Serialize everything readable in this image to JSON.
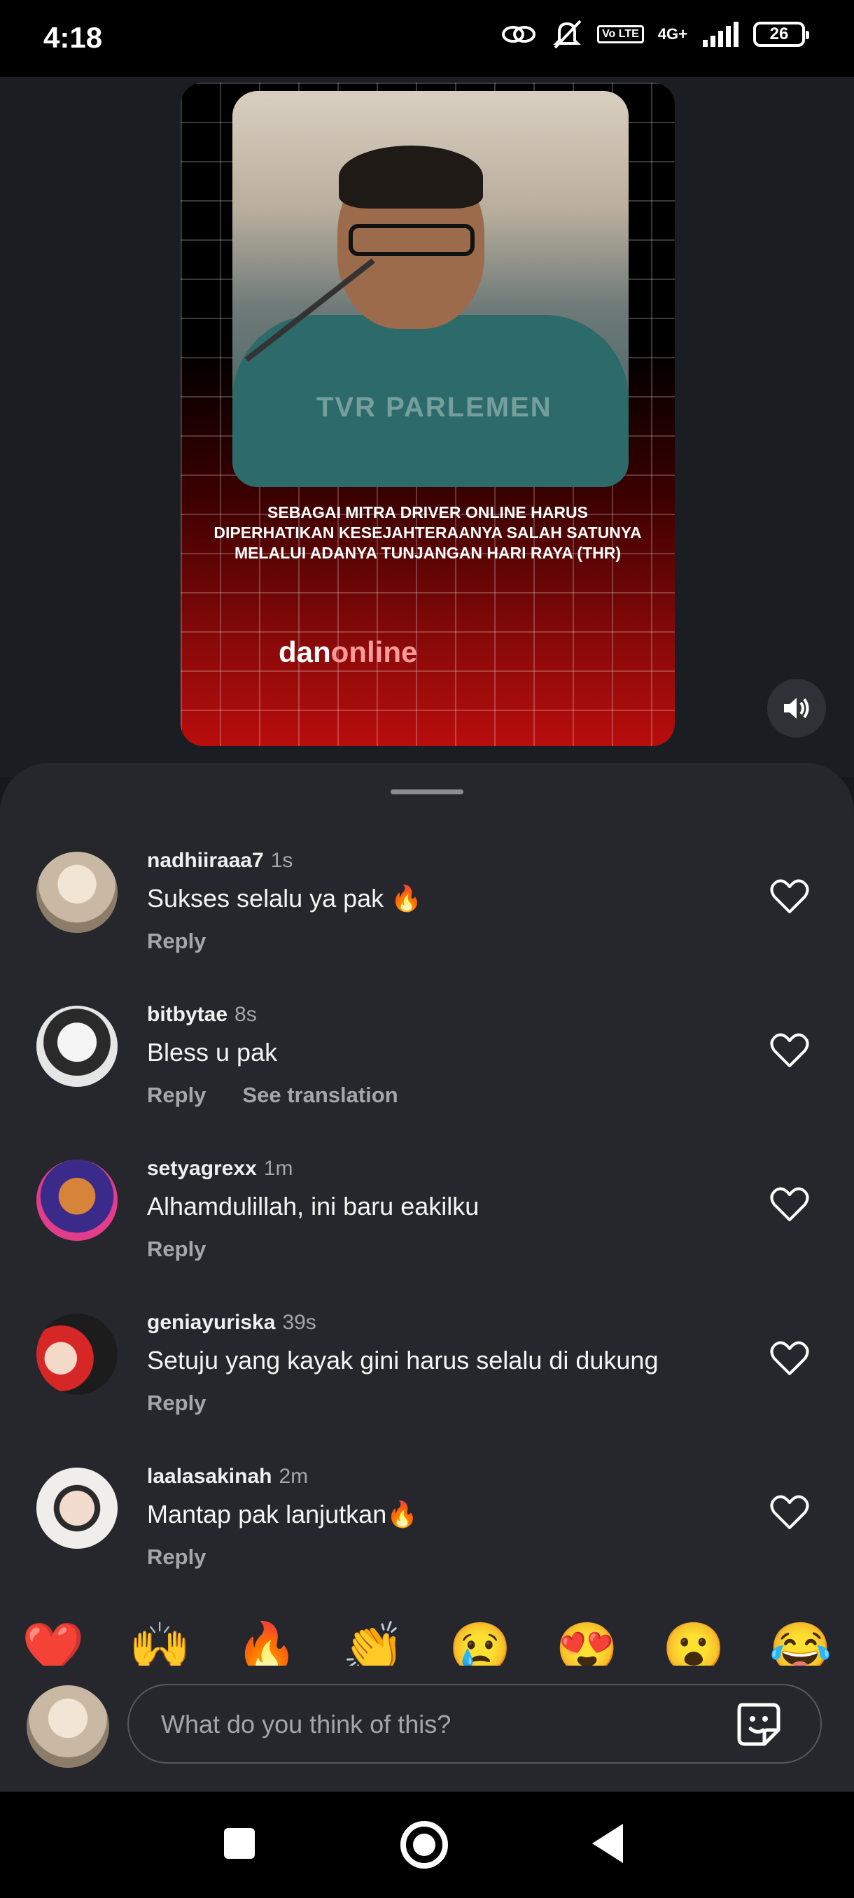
{
  "status_bar": {
    "time": "4:18",
    "battery": "26",
    "network": "4G+",
    "lte_label": "Vo LTE"
  },
  "video": {
    "caption": "SEBAGAI MITRA DRIVER ONLINE HARUS DIPERHATIKAN KESEJAHTERAANYA SALAH SATUNYA MELALUI ADANYA TUNJANGAN HARI RAYA (THR)",
    "brand_part1": "dan",
    "brand_part2": "online",
    "watermark": "TVR PARLEMEN"
  },
  "comments": [
    {
      "username": "nadhiiraaa7",
      "time": "1s",
      "text": "Sukses selalu ya pak 🔥",
      "reply_label": "Reply",
      "translate_label": "",
      "avatar_color": "#c9b9a4"
    },
    {
      "username": "bitbytae",
      "time": "8s",
      "text": "Bless u pak",
      "reply_label": "Reply",
      "translate_label": "See translation",
      "avatar_color": "#d8d8d8"
    },
    {
      "username": "setyagrexx",
      "time": "1m",
      "text": "Alhamdulillah, ini baru eakilku",
      "reply_label": "Reply",
      "translate_label": "",
      "avatar_color": "#3a2a8a"
    },
    {
      "username": "geniayuriska",
      "time": "39s",
      "text": "Setuju yang kayak gini harus selalu di dukung",
      "reply_label": "Reply",
      "translate_label": "",
      "avatar_color": "#1c1c1c"
    },
    {
      "username": "laalasakinah",
      "time": "2m",
      "text": "Mantap pak lanjutkan🔥",
      "reply_label": "Reply",
      "translate_label": "",
      "avatar_color": "#e8e6e2"
    }
  ],
  "emoji_reactions": [
    "❤️",
    "🙌",
    "🔥",
    "👏",
    "😢",
    "😍",
    "😮",
    "😂"
  ],
  "composer": {
    "placeholder": "What do you think of this?"
  }
}
